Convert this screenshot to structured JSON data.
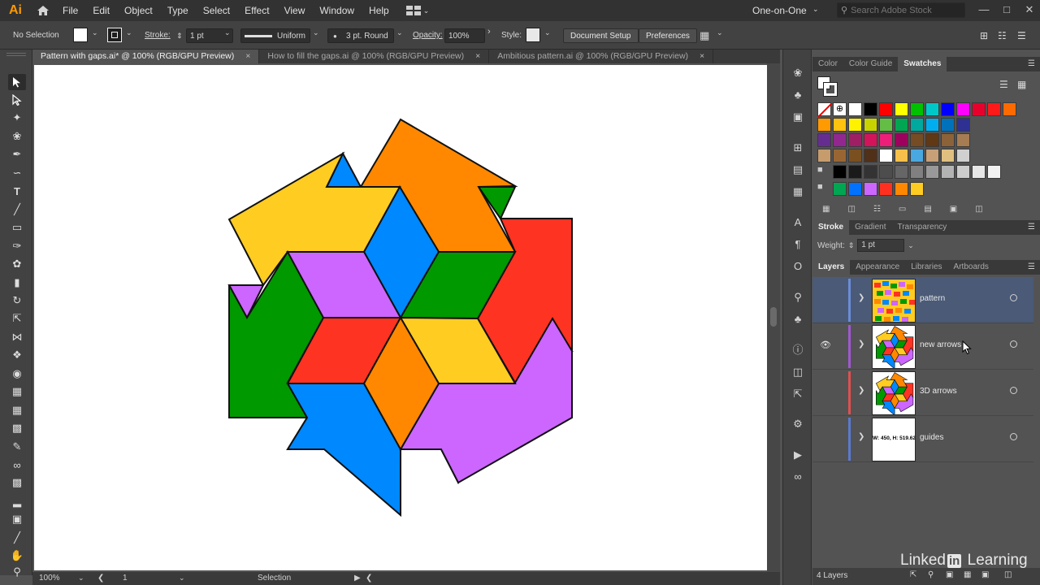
{
  "app": {
    "logo": "Ai",
    "menu": [
      "File",
      "Edit",
      "Object",
      "Type",
      "Select",
      "Effect",
      "View",
      "Window",
      "Help"
    ],
    "workspace": "One-on-One",
    "search_placeholder": "Search Adobe Stock"
  },
  "control_bar": {
    "selection": "No Selection",
    "stroke_label": "Stroke:",
    "stroke_weight": "1 pt",
    "profile": "Uniform",
    "brush": "3 pt. Round",
    "opacity_label": "Opacity:",
    "opacity": "100%",
    "style_label": "Style:",
    "document_setup": "Document Setup",
    "preferences": "Preferences"
  },
  "tabs": [
    {
      "label": "Pattern with gaps.ai* @ 100% (RGB/GPU Preview)",
      "close": "×"
    },
    {
      "label": "How to fill the gaps.ai @ 100% (RGB/GPU Preview)",
      "close": "×"
    },
    {
      "label": "Ambitious pattern.ai @ 100% (RGB/GPU Preview)",
      "close": "×"
    }
  ],
  "status_bar": {
    "zoom": "100%",
    "artboard": "1",
    "tool": "Selection"
  },
  "swatches_panel": {
    "tabs": [
      "Color",
      "Color Guide",
      "Swatches"
    ],
    "colors_row1": [
      "#000000",
      "#ff0000",
      "#ffff00",
      "#00c000",
      "#00c8c8",
      "#0000ff",
      "#ff00ff",
      "#e8002c",
      "#ff1a1a",
      "#ff6a00"
    ],
    "colors_row2": [
      "#ff9a00",
      "#ffc20e",
      "#fff200",
      "#c8d400",
      "#64bd45",
      "#00a651",
      "#00a99d",
      "#00aeef",
      "#0072bc",
      "#2e3192"
    ],
    "colors_row3": [
      "#662d91",
      "#92278f",
      "#9e1f63",
      "#d4145a",
      "#ed1e79",
      "#9e005d",
      "#754c24",
      "#603813",
      "#8c6239",
      "#a67c52"
    ],
    "colors_row4": [
      "#c69c6d",
      "#996633",
      "#7a5020",
      "#503018",
      "#ffffff",
      "#f7c04a",
      "#4aa8e0",
      "#c8a078",
      "#e0c080",
      "#d0d0d0"
    ],
    "grays": [
      "#000000",
      "#1a1a1a",
      "#333333",
      "#4d4d4d",
      "#666666",
      "#808080",
      "#999999",
      "#b3b3b3",
      "#cccccc",
      "#e6e6e6",
      "#f2f2f2"
    ],
    "group_colors": [
      "#00a651",
      "#0072ff",
      "#cc66ff",
      "#ff3020",
      "#ff8800",
      "#ffcc22"
    ]
  },
  "stroke_panel": {
    "tabs": [
      "Stroke",
      "Gradient",
      "Transparency"
    ],
    "weight_label": "Weight:",
    "weight": "1 pt"
  },
  "layers_panel": {
    "tabs": [
      "Layers",
      "Appearance",
      "Libraries",
      "Artboards"
    ],
    "layers": [
      {
        "name": "pattern",
        "color": "#6b8dd6",
        "visible": false,
        "selected": true
      },
      {
        "name": "new arrows",
        "color": "#a058d0",
        "visible": true,
        "selected": false
      },
      {
        "name": "3D arrows",
        "color": "#e05050",
        "visible": false,
        "selected": false
      },
      {
        "name": "guides",
        "color": "#5a7ad0",
        "visible": false,
        "selected": false,
        "thumb_text": "W: 450, H: 519.62"
      }
    ],
    "count": "4 Layers"
  },
  "brand": {
    "text1": "Linked",
    "text2": "in",
    "text3": "Learning"
  },
  "colors": {
    "blue": "#0088ff",
    "orange": "#ff8800",
    "yellow": "#ffcc22",
    "purple": "#cc66ff",
    "green": "#009900",
    "red": "#ff3322"
  }
}
